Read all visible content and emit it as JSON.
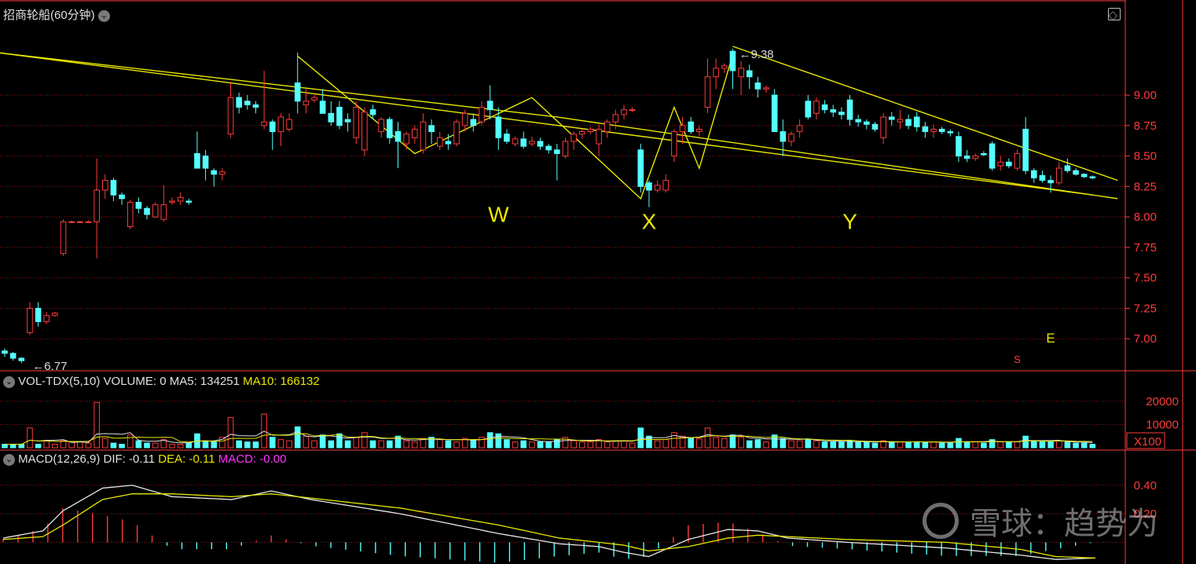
{
  "colors": {
    "up": "#ff3b3b",
    "down": "#54ffff",
    "grid": "#8b1a1a",
    "trend": "#e8e800",
    "dif": "#e8e8e8",
    "dea": "#e8e800",
    "macd": "#ff33ff",
    "axis": "#ff3b3b"
  },
  "header": {
    "title": "招商轮船(60分钟)",
    "dropdown_icon": "chevron-down-icon"
  },
  "volume_header": {
    "name": "VOL-TDX(5,10)",
    "volume": "VOLUME: 0",
    "ma5": "MA5: 134251",
    "ma10": "MA10: 166132"
  },
  "macd_header": {
    "name": "MACD(12,26,9)",
    "dif": "DIF: -0.11",
    "dea": "DEA: -0.11",
    "macd": "MACD: -0.00"
  },
  "watermark": {
    "text": "雪球：趋势为"
  },
  "chart_data": [
    {
      "type": "candlestick",
      "title": "招商轮船(60分钟)",
      "ylim": [
        6.75,
        9.6
      ],
      "yticks": [
        "9.00",
        "8.75",
        "8.50",
        "8.25",
        "8.00",
        "7.75",
        "7.50",
        "7.25",
        "7.00"
      ],
      "annotations": [
        {
          "text": "9.38",
          "type": "max-price"
        },
        {
          "text": "6.77",
          "type": "min-price"
        },
        {
          "text": "W",
          "type": "wave-label"
        },
        {
          "text": "X",
          "type": "wave-label"
        },
        {
          "text": "Y",
          "type": "wave-label"
        },
        {
          "text": "E",
          "type": "wave-label"
        },
        {
          "text": "S",
          "type": "signal"
        }
      ],
      "candles": [
        [
          6.9,
          6.92,
          6.85,
          6.88
        ],
        [
          6.88,
          6.89,
          6.82,
          6.84
        ],
        [
          6.84,
          6.85,
          6.8,
          6.82
        ],
        [
          7.05,
          7.3,
          7.03,
          7.25
        ],
        [
          7.25,
          7.3,
          7.1,
          7.14
        ],
        [
          7.14,
          7.22,
          7.12,
          7.19
        ],
        [
          7.19,
          7.22,
          7.18,
          7.21
        ],
        [
          7.7,
          7.98,
          7.68,
          7.96
        ],
        [
          7.96,
          7.97,
          7.95,
          7.96
        ],
        [
          7.96,
          7.97,
          7.95,
          7.96
        ],
        [
          7.96,
          7.97,
          7.95,
          7.96
        ],
        [
          7.96,
          8.48,
          7.66,
          8.22
        ],
        [
          8.22,
          8.35,
          8.15,
          8.3
        ],
        [
          8.3,
          8.32,
          8.13,
          8.18
        ],
        [
          8.18,
          8.2,
          8.1,
          8.15
        ],
        [
          7.92,
          8.14,
          7.9,
          8.12
        ],
        [
          8.12,
          8.16,
          8.03,
          8.07
        ],
        [
          8.07,
          8.09,
          7.98,
          8.02
        ],
        [
          8.0,
          8.12,
          7.99,
          8.1
        ],
        [
          7.98,
          8.26,
          7.96,
          8.1
        ],
        [
          8.12,
          8.16,
          8.1,
          8.13
        ],
        [
          8.13,
          8.2,
          8.1,
          8.16
        ],
        [
          8.13,
          8.15,
          8.1,
          8.12
        ],
        [
          8.52,
          8.7,
          8.49,
          8.4
        ],
        [
          8.5,
          8.55,
          8.3,
          8.4
        ],
        [
          8.38,
          8.4,
          8.25,
          8.35
        ],
        [
          8.35,
          8.4,
          8.3,
          8.37
        ],
        [
          8.68,
          9.1,
          8.65,
          8.98
        ],
        [
          8.98,
          9.02,
          8.85,
          8.9
        ],
        [
          8.95,
          9.0,
          8.88,
          8.92
        ],
        [
          8.92,
          8.95,
          8.85,
          8.9
        ],
        [
          8.75,
          9.2,
          8.72,
          8.78
        ],
        [
          8.78,
          8.8,
          8.55,
          8.7
        ],
        [
          8.7,
          8.85,
          8.58,
          8.82
        ],
        [
          8.72,
          8.85,
          8.7,
          8.8
        ],
        [
          9.1,
          9.35,
          8.85,
          8.95
        ],
        [
          8.92,
          9.05,
          8.85,
          8.95
        ],
        [
          8.96,
          9.0,
          8.94,
          8.98
        ],
        [
          8.95,
          9.05,
          8.9,
          8.85
        ],
        [
          8.85,
          8.95,
          8.75,
          8.78
        ],
        [
          8.9,
          8.95,
          8.72,
          8.75
        ],
        [
          8.8,
          8.85,
          8.7,
          8.78
        ],
        [
          8.65,
          8.95,
          8.6,
          8.9
        ],
        [
          8.55,
          8.9,
          8.5,
          8.86
        ],
        [
          8.88,
          8.92,
          8.8,
          8.84
        ],
        [
          8.7,
          8.82,
          8.65,
          8.8
        ],
        [
          8.8,
          8.82,
          8.6,
          8.65
        ],
        [
          8.7,
          8.78,
          8.4,
          8.62
        ],
        [
          8.6,
          8.7,
          8.55,
          8.68
        ],
        [
          8.65,
          8.75,
          8.6,
          8.72
        ],
        [
          8.55,
          8.85,
          8.52,
          8.78
        ],
        [
          8.75,
          8.8,
          8.6,
          8.7
        ],
        [
          8.58,
          8.7,
          8.55,
          8.65
        ],
        [
          8.62,
          8.68,
          8.55,
          8.6
        ],
        [
          8.6,
          8.8,
          8.58,
          8.78
        ],
        [
          8.75,
          8.88,
          8.7,
          8.85
        ],
        [
          8.8,
          8.85,
          8.7,
          8.75
        ],
        [
          8.78,
          8.95,
          8.75,
          8.9
        ],
        [
          8.95,
          9.08,
          8.8,
          8.88
        ],
        [
          8.82,
          8.9,
          8.55,
          8.65
        ],
        [
          8.68,
          8.72,
          8.6,
          8.62
        ],
        [
          8.6,
          8.66,
          8.58,
          8.64
        ],
        [
          8.64,
          8.7,
          8.56,
          8.58
        ],
        [
          8.6,
          8.66,
          8.58,
          8.62
        ],
        [
          8.62,
          8.65,
          8.55,
          8.58
        ],
        [
          8.58,
          8.6,
          8.52,
          8.55
        ],
        [
          8.55,
          8.6,
          8.3,
          8.52
        ],
        [
          8.5,
          8.65,
          8.48,
          8.62
        ],
        [
          8.62,
          8.7,
          8.55,
          8.68
        ],
        [
          8.68,
          8.72,
          8.64,
          8.7
        ],
        [
          8.7,
          8.74,
          8.68,
          8.72
        ],
        [
          8.6,
          8.76,
          8.5,
          8.72
        ],
        [
          8.7,
          8.8,
          8.65,
          8.78
        ],
        [
          8.78,
          8.88,
          8.72,
          8.84
        ],
        [
          8.84,
          8.92,
          8.8,
          8.88
        ],
        [
          8.88,
          8.9,
          8.86,
          8.88
        ],
        [
          8.55,
          8.6,
          8.2,
          8.25
        ],
        [
          8.28,
          8.3,
          8.08,
          8.22
        ],
        [
          8.22,
          8.3,
          8.2,
          8.26
        ],
        [
          8.22,
          8.35,
          8.2,
          8.3
        ],
        [
          8.5,
          8.72,
          8.45,
          8.7
        ],
        [
          8.7,
          8.82,
          8.6,
          8.75
        ],
        [
          8.78,
          8.82,
          8.68,
          8.7
        ],
        [
          8.7,
          8.75,
          8.66,
          8.72
        ],
        [
          8.9,
          9.3,
          8.85,
          9.15
        ],
        [
          9.15,
          9.3,
          9.05,
          9.22
        ],
        [
          9.22,
          9.26,
          9.18,
          9.24
        ],
        [
          9.36,
          9.38,
          9.05,
          9.2
        ],
        [
          9.15,
          9.28,
          9.0,
          9.22
        ],
        [
          9.2,
          9.25,
          9.05,
          9.15
        ],
        [
          9.1,
          9.15,
          8.98,
          9.05
        ],
        [
          9.05,
          9.08,
          9.02,
          9.06
        ],
        [
          9.0,
          9.05,
          8.7,
          8.7
        ],
        [
          8.7,
          8.8,
          8.5,
          8.62
        ],
        [
          8.62,
          8.7,
          8.58,
          8.68
        ],
        [
          8.7,
          8.8,
          8.65,
          8.75
        ],
        [
          8.95,
          9.0,
          8.8,
          8.82
        ],
        [
          8.85,
          8.98,
          8.8,
          8.95
        ],
        [
          8.92,
          8.96,
          8.85,
          8.88
        ],
        [
          8.88,
          8.92,
          8.82,
          8.86
        ],
        [
          8.86,
          8.9,
          8.8,
          8.84
        ],
        [
          8.96,
          9.0,
          8.75,
          8.8
        ],
        [
          8.8,
          8.84,
          8.74,
          8.78
        ],
        [
          8.78,
          8.8,
          8.72,
          8.76
        ],
        [
          8.76,
          8.78,
          8.7,
          8.72
        ],
        [
          8.65,
          8.85,
          8.6,
          8.82
        ],
        [
          8.82,
          8.86,
          8.75,
          8.8
        ],
        [
          8.78,
          8.88,
          8.72,
          8.8
        ],
        [
          8.8,
          8.84,
          8.72,
          8.75
        ],
        [
          8.82,
          8.86,
          8.7,
          8.74
        ],
        [
          8.74,
          8.78,
          8.65,
          8.7
        ],
        [
          8.7,
          8.76,
          8.65,
          8.72
        ],
        [
          8.72,
          8.74,
          8.68,
          8.7
        ],
        [
          8.7,
          8.72,
          8.66,
          8.69
        ],
        [
          8.66,
          8.7,
          8.45,
          8.5
        ],
        [
          8.5,
          8.55,
          8.45,
          8.48
        ],
        [
          8.48,
          8.52,
          8.46,
          8.5
        ],
        [
          8.52,
          8.54,
          8.5,
          8.51
        ],
        [
          8.6,
          8.62,
          8.38,
          8.4
        ],
        [
          8.42,
          8.5,
          8.38,
          8.45
        ],
        [
          8.45,
          8.48,
          8.4,
          8.42
        ],
        [
          8.4,
          8.55,
          8.38,
          8.52
        ],
        [
          8.72,
          8.82,
          8.35,
          8.38
        ],
        [
          8.38,
          8.4,
          8.28,
          8.32
        ],
        [
          8.34,
          8.38,
          8.28,
          8.3
        ],
        [
          8.3,
          8.34,
          8.2,
          8.28
        ],
        [
          8.28,
          8.45,
          8.26,
          8.4
        ],
        [
          8.42,
          8.48,
          8.36,
          8.38
        ],
        [
          8.38,
          8.4,
          8.34,
          8.35
        ],
        [
          8.35,
          8.36,
          8.32,
          8.33
        ],
        [
          8.33,
          8.34,
          8.31,
          8.32
        ]
      ]
    },
    {
      "type": "bar",
      "title": "VOL-TDX(5,10)",
      "ylim": [
        0,
        25000
      ],
      "yticks": [
        "20000",
        "10000"
      ],
      "unit_label": "X100",
      "values": [
        1500,
        1500,
        1500,
        8500,
        1500,
        3000,
        1500,
        3000,
        2500,
        2500,
        2000,
        19500,
        4000,
        2000,
        1500,
        5500,
        3000,
        2000,
        2000,
        3500,
        1500,
        1500,
        2000,
        6000,
        3000,
        2500,
        4500,
        13000,
        3000,
        2500,
        2500,
        14500,
        4500,
        3500,
        3000,
        9000,
        5000,
        3000,
        5500,
        3000,
        6000,
        3000,
        4500,
        6500,
        3000,
        3000,
        3000,
        5000,
        3000,
        2500,
        4000,
        4500,
        3500,
        3000,
        2500,
        4000,
        3500,
        4500,
        6500,
        6000,
        3500,
        2500,
        3000,
        2500,
        2500,
        2500,
        3500,
        4500,
        3000,
        2500,
        2500,
        3500,
        2500,
        3000,
        3000,
        2000,
        8500,
        5000,
        3000,
        3500,
        6500,
        5000,
        4000,
        4000,
        8500,
        4500,
        4000,
        5500,
        4500,
        3000,
        3500,
        2500,
        5500,
        4000,
        3000,
        3000,
        3500,
        3000,
        2500,
        2500,
        2500,
        3000,
        2500,
        2500,
        2000,
        3000,
        2500,
        2500,
        2500,
        2500,
        2500,
        2500,
        2000,
        2000,
        4000,
        2500,
        2500,
        2000,
        3500,
        2500,
        2500,
        2500,
        5000,
        3000,
        2500,
        2500,
        3000,
        2500,
        2000,
        2000,
        1500
      ]
    },
    {
      "type": "line",
      "title": "MACD(12,26,9)",
      "ylim": [
        -0.13,
        0.52
      ],
      "yticks": [
        "0.40",
        "0.20"
      ],
      "series": [
        {
          "name": "DIF"
        },
        {
          "name": "DEA"
        },
        {
          "name": "MACD"
        }
      ],
      "keypoints": [
        [
          0,
          0.03,
          0.02
        ],
        [
          8,
          0.08,
          0.04
        ],
        [
          12,
          0.22,
          0.12
        ],
        [
          20,
          0.38,
          0.3
        ],
        [
          26,
          0.4,
          0.34
        ],
        [
          34,
          0.32,
          0.34
        ],
        [
          46,
          0.3,
          0.32
        ],
        [
          54,
          0.36,
          0.34
        ],
        [
          62,
          0.3,
          0.31
        ],
        [
          80,
          0.2,
          0.24
        ],
        [
          100,
          0.06,
          0.12
        ],
        [
          112,
          -0.01,
          0.03
        ],
        [
          120,
          -0.03,
          0.0
        ],
        [
          125,
          -0.07,
          -0.02
        ],
        [
          130,
          -0.1,
          -0.06
        ],
        [
          138,
          0.02,
          -0.03
        ],
        [
          146,
          0.09,
          0.03
        ],
        [
          152,
          0.08,
          0.05
        ],
        [
          158,
          0.03,
          0.04
        ],
        [
          170,
          0.0,
          0.02
        ],
        [
          190,
          -0.04,
          0.0
        ],
        [
          205,
          -0.09,
          -0.05
        ],
        [
          212,
          -0.12,
          -0.1
        ],
        [
          220,
          -0.11,
          -0.11
        ]
      ]
    }
  ]
}
